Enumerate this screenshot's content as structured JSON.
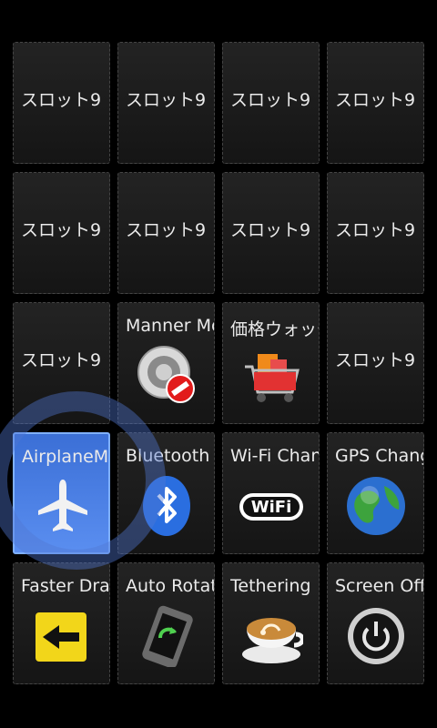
{
  "tiles": [
    {
      "label": "スロット9",
      "kind": "empty"
    },
    {
      "label": "スロット9",
      "kind": "empty"
    },
    {
      "label": "スロット9",
      "kind": "empty"
    },
    {
      "label": "スロット9",
      "kind": "empty"
    },
    {
      "label": "スロット9",
      "kind": "empty"
    },
    {
      "label": "スロット9",
      "kind": "empty"
    },
    {
      "label": "スロット9",
      "kind": "empty"
    },
    {
      "label": "スロット9",
      "kind": "empty"
    },
    {
      "label": "スロット9",
      "kind": "empty"
    },
    {
      "label": "Manner Mode",
      "icon": "manner-mode-icon"
    },
    {
      "label": "価格ウォッチ",
      "icon": "shopping-cart-icon"
    },
    {
      "label": "スロット9",
      "kind": "empty"
    },
    {
      "label": "AirplaneMode",
      "icon": "airplane-icon",
      "active": true
    },
    {
      "label": "Bluetooth",
      "icon": "bluetooth-icon"
    },
    {
      "label": "Wi-Fi Change",
      "icon": "wifi-icon"
    },
    {
      "label": "GPS Change",
      "icon": "globe-icon"
    },
    {
      "label": "Faster Draw",
      "icon": "arrow-left-icon"
    },
    {
      "label": "Auto Rotate",
      "icon": "phone-rotate-icon"
    },
    {
      "label": "Tethering",
      "icon": "coffee-cup-icon"
    },
    {
      "label": "Screen Off",
      "icon": "power-icon"
    }
  ],
  "colors": {
    "active_tile": "#4a7fe6",
    "ring": "#5078d2"
  }
}
